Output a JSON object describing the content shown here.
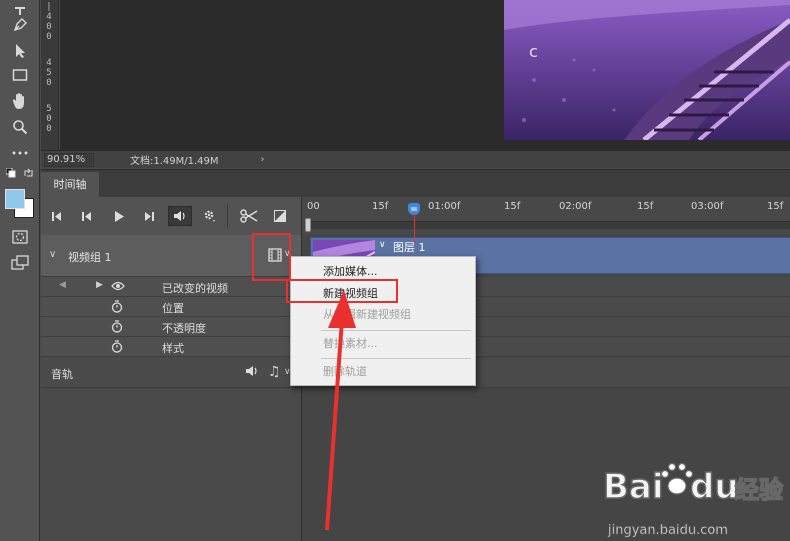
{
  "status": {
    "zoom": "90.91%",
    "doc_info": "文档:1.49M/1.49M",
    "arrow": "›"
  },
  "ruler_numbers": [
    {
      "label": "4\n0\n0"
    },
    {
      "label": "4\n5\n0"
    },
    {
      "label": "5\n0\n0"
    }
  ],
  "panel": {
    "tab": "时间轴"
  },
  "timeline": {
    "ticks": [
      "00",
      "15f",
      "01:00f",
      "15f",
      "02:00f",
      "15f",
      "03:00f",
      "15f"
    ]
  },
  "tracks": {
    "video_group": "视频组 1",
    "clip_label": "图层 1",
    "properties": [
      {
        "label": "已改变的视频",
        "icon": "eye-icon"
      },
      {
        "label": "位置",
        "icon": "stopwatch-icon"
      },
      {
        "label": "不透明度",
        "icon": "stopwatch-icon"
      },
      {
        "label": "样式",
        "icon": "stopwatch-icon"
      }
    ],
    "audio": "音轨"
  },
  "context_menu": {
    "items": [
      {
        "label": "添加媒体...",
        "enabled": true
      },
      {
        "label": "新建视频组",
        "enabled": true
      },
      {
        "label": "从剪辑新建视频组",
        "enabled": false
      },
      {
        "label": "替换素材...",
        "enabled": false
      },
      {
        "label": "删除轨道",
        "enabled": false
      }
    ]
  },
  "colors": {
    "annotation_red": "#e8302e",
    "clip_blue": "#5a72a4",
    "playhead_blue": "#3e88e0"
  }
}
